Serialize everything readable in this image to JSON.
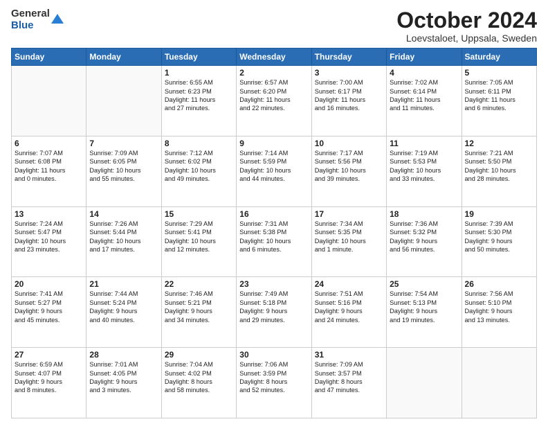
{
  "header": {
    "logo_general": "General",
    "logo_blue": "Blue",
    "title": "October 2024",
    "location": "Loevstaloet, Uppsala, Sweden"
  },
  "days_of_week": [
    "Sunday",
    "Monday",
    "Tuesday",
    "Wednesday",
    "Thursday",
    "Friday",
    "Saturday"
  ],
  "weeks": [
    [
      {
        "day": "",
        "text": ""
      },
      {
        "day": "",
        "text": ""
      },
      {
        "day": "1",
        "text": "Sunrise: 6:55 AM\nSunset: 6:23 PM\nDaylight: 11 hours\nand 27 minutes."
      },
      {
        "day": "2",
        "text": "Sunrise: 6:57 AM\nSunset: 6:20 PM\nDaylight: 11 hours\nand 22 minutes."
      },
      {
        "day": "3",
        "text": "Sunrise: 7:00 AM\nSunset: 6:17 PM\nDaylight: 11 hours\nand 16 minutes."
      },
      {
        "day": "4",
        "text": "Sunrise: 7:02 AM\nSunset: 6:14 PM\nDaylight: 11 hours\nand 11 minutes."
      },
      {
        "day": "5",
        "text": "Sunrise: 7:05 AM\nSunset: 6:11 PM\nDaylight: 11 hours\nand 6 minutes."
      }
    ],
    [
      {
        "day": "6",
        "text": "Sunrise: 7:07 AM\nSunset: 6:08 PM\nDaylight: 11 hours\nand 0 minutes."
      },
      {
        "day": "7",
        "text": "Sunrise: 7:09 AM\nSunset: 6:05 PM\nDaylight: 10 hours\nand 55 minutes."
      },
      {
        "day": "8",
        "text": "Sunrise: 7:12 AM\nSunset: 6:02 PM\nDaylight: 10 hours\nand 49 minutes."
      },
      {
        "day": "9",
        "text": "Sunrise: 7:14 AM\nSunset: 5:59 PM\nDaylight: 10 hours\nand 44 minutes."
      },
      {
        "day": "10",
        "text": "Sunrise: 7:17 AM\nSunset: 5:56 PM\nDaylight: 10 hours\nand 39 minutes."
      },
      {
        "day": "11",
        "text": "Sunrise: 7:19 AM\nSunset: 5:53 PM\nDaylight: 10 hours\nand 33 minutes."
      },
      {
        "day": "12",
        "text": "Sunrise: 7:21 AM\nSunset: 5:50 PM\nDaylight: 10 hours\nand 28 minutes."
      }
    ],
    [
      {
        "day": "13",
        "text": "Sunrise: 7:24 AM\nSunset: 5:47 PM\nDaylight: 10 hours\nand 23 minutes."
      },
      {
        "day": "14",
        "text": "Sunrise: 7:26 AM\nSunset: 5:44 PM\nDaylight: 10 hours\nand 17 minutes."
      },
      {
        "day": "15",
        "text": "Sunrise: 7:29 AM\nSunset: 5:41 PM\nDaylight: 10 hours\nand 12 minutes."
      },
      {
        "day": "16",
        "text": "Sunrise: 7:31 AM\nSunset: 5:38 PM\nDaylight: 10 hours\nand 6 minutes."
      },
      {
        "day": "17",
        "text": "Sunrise: 7:34 AM\nSunset: 5:35 PM\nDaylight: 10 hours\nand 1 minute."
      },
      {
        "day": "18",
        "text": "Sunrise: 7:36 AM\nSunset: 5:32 PM\nDaylight: 9 hours\nand 56 minutes."
      },
      {
        "day": "19",
        "text": "Sunrise: 7:39 AM\nSunset: 5:30 PM\nDaylight: 9 hours\nand 50 minutes."
      }
    ],
    [
      {
        "day": "20",
        "text": "Sunrise: 7:41 AM\nSunset: 5:27 PM\nDaylight: 9 hours\nand 45 minutes."
      },
      {
        "day": "21",
        "text": "Sunrise: 7:44 AM\nSunset: 5:24 PM\nDaylight: 9 hours\nand 40 minutes."
      },
      {
        "day": "22",
        "text": "Sunrise: 7:46 AM\nSunset: 5:21 PM\nDaylight: 9 hours\nand 34 minutes."
      },
      {
        "day": "23",
        "text": "Sunrise: 7:49 AM\nSunset: 5:18 PM\nDaylight: 9 hours\nand 29 minutes."
      },
      {
        "day": "24",
        "text": "Sunrise: 7:51 AM\nSunset: 5:16 PM\nDaylight: 9 hours\nand 24 minutes."
      },
      {
        "day": "25",
        "text": "Sunrise: 7:54 AM\nSunset: 5:13 PM\nDaylight: 9 hours\nand 19 minutes."
      },
      {
        "day": "26",
        "text": "Sunrise: 7:56 AM\nSunset: 5:10 PM\nDaylight: 9 hours\nand 13 minutes."
      }
    ],
    [
      {
        "day": "27",
        "text": "Sunrise: 6:59 AM\nSunset: 4:07 PM\nDaylight: 9 hours\nand 8 minutes."
      },
      {
        "day": "28",
        "text": "Sunrise: 7:01 AM\nSunset: 4:05 PM\nDaylight: 9 hours\nand 3 minutes."
      },
      {
        "day": "29",
        "text": "Sunrise: 7:04 AM\nSunset: 4:02 PM\nDaylight: 8 hours\nand 58 minutes."
      },
      {
        "day": "30",
        "text": "Sunrise: 7:06 AM\nSunset: 3:59 PM\nDaylight: 8 hours\nand 52 minutes."
      },
      {
        "day": "31",
        "text": "Sunrise: 7:09 AM\nSunset: 3:57 PM\nDaylight: 8 hours\nand 47 minutes."
      },
      {
        "day": "",
        "text": ""
      },
      {
        "day": "",
        "text": ""
      }
    ]
  ]
}
